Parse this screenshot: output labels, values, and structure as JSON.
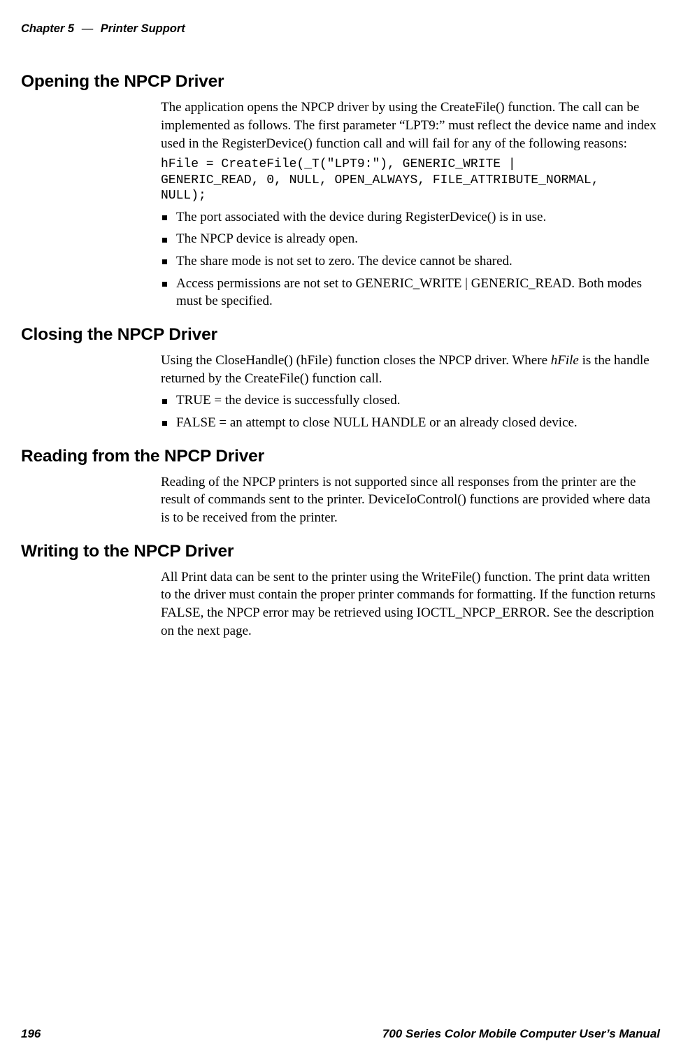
{
  "header": {
    "chapter_label": "Chapter 5",
    "separator": "—",
    "section_title": "Printer Support"
  },
  "sections": {
    "opening": {
      "heading": "Opening the NPCP Driver",
      "intro": "The application opens the NPCP driver by using the CreateFile() function. The call can be implemented as follows. The first parameter “LPT9:” must reflect the device name and index used in the RegisterDevice() function call and will fail for any of the following reasons:",
      "code": "hFile = CreateFile(_T(\"LPT9:\"), GENERIC_WRITE |\nGENERIC_READ, 0, NULL, OPEN_ALWAYS, FILE_ATTRIBUTE_NORMAL,\nNULL);",
      "bullets": [
        "The port associated with the device during RegisterDevice() is in use.",
        "The NPCP device is already open.",
        "The share mode is not set to zero. The device cannot be shared.",
        "Access permissions are not set to GENERIC_WRITE | GENERIC_READ. Both modes must be specified."
      ]
    },
    "closing": {
      "heading": "Closing the NPCP Driver",
      "intro_prefix": "Using the CloseHandle() (hFile) function closes the NPCP driver. Where ",
      "intro_italic": "hFile",
      "intro_suffix": " is the handle returned by the CreateFile() function call.",
      "bullets": [
        "TRUE = the device is successfully closed.",
        "FALSE = an attempt to close NULL HANDLE or an already closed device."
      ]
    },
    "reading": {
      "heading": "Reading from the NPCP Driver",
      "body": "Reading of the NPCP printers is not supported since all responses from the printer are the result of commands sent to the printer. DeviceIoControl() functions are provided where data is to be received from the printer."
    },
    "writing": {
      "heading": "Writing to the NPCP Driver",
      "body": "All Print data can be sent to the printer using the WriteFile() function. The print data written to the driver must contain the proper printer commands for formatting. If the function returns FALSE, the NPCP error may be retrieved using IOCTL_NPCP_ERROR. See the description on the next page."
    }
  },
  "footer": {
    "page_number": "196",
    "manual_title": "700 Series Color Mobile Computer User’s Manual"
  }
}
